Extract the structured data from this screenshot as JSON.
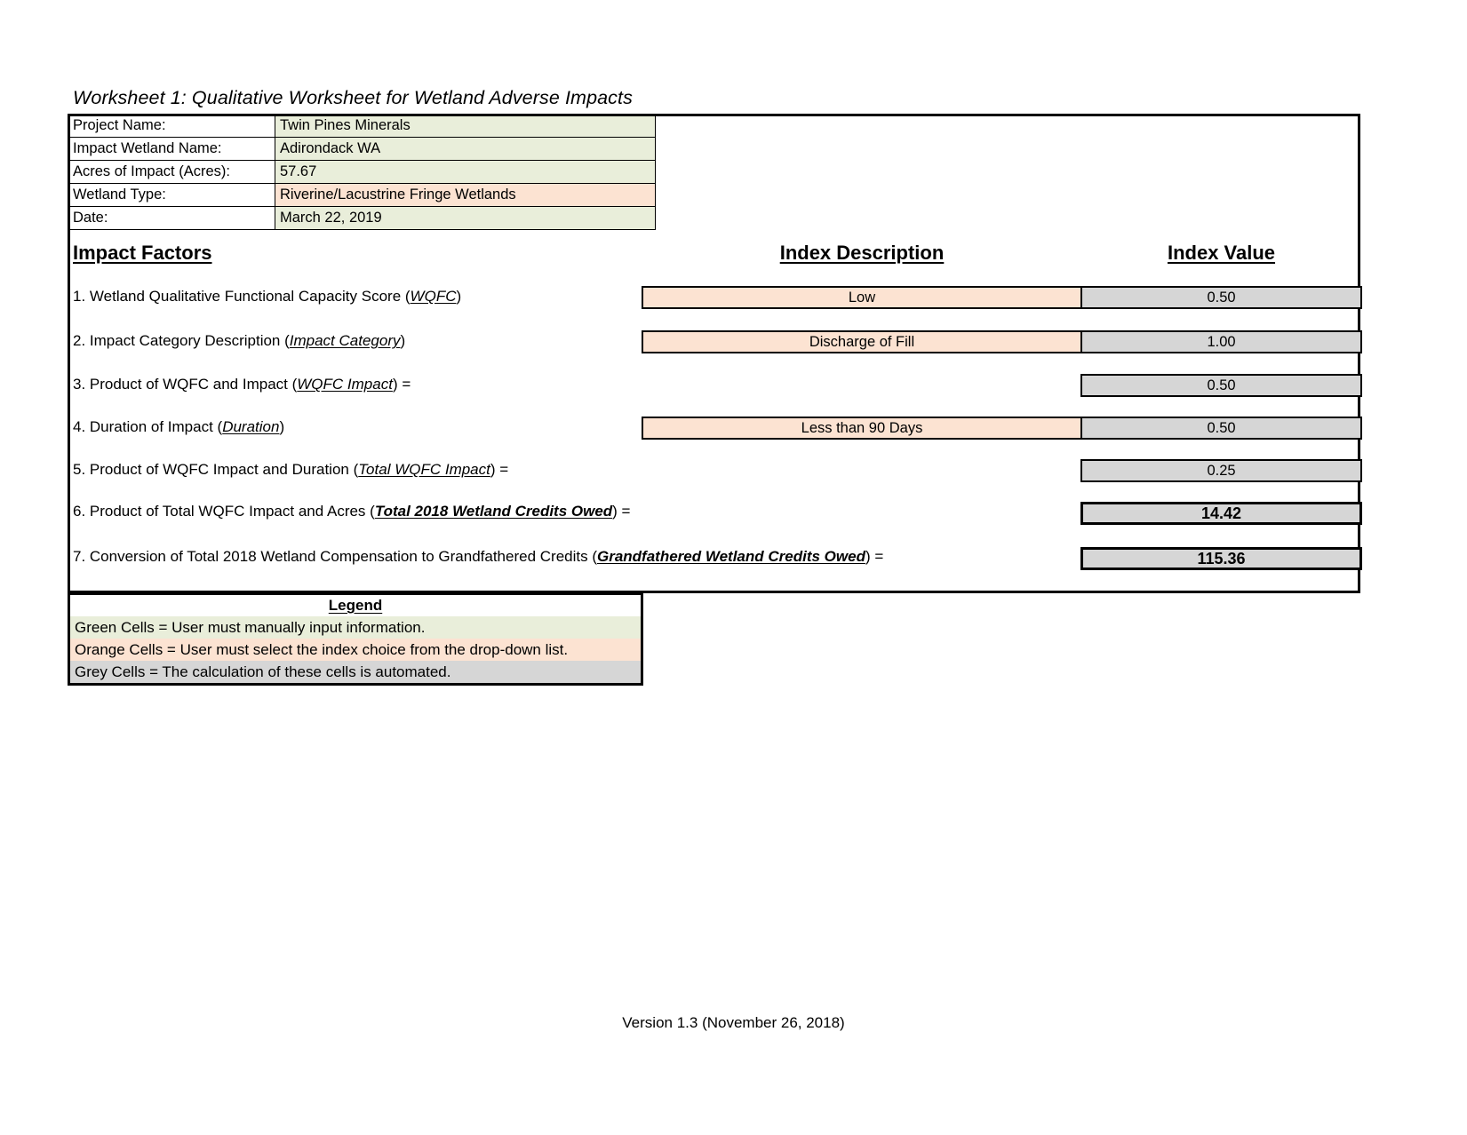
{
  "title": "Worksheet 1:  Qualitative Worksheet for Wetland Adverse Impacts",
  "info": {
    "rows": [
      {
        "label": "Project Name:",
        "value": "Twin Pines Minerals",
        "fill": "green"
      },
      {
        "label": "Impact Wetland Name:",
        "value": "Adirondack WA",
        "fill": "green"
      },
      {
        "label": "Acres of Impact (Acres):",
        "value": "57.67",
        "fill": "green"
      },
      {
        "label": "Wetland Type:",
        "value": "Riverine/Lacustrine Fringe Wetlands",
        "fill": "orange"
      },
      {
        "label": "Date:",
        "value": "March 22, 2019",
        "fill": "green"
      }
    ]
  },
  "columns": {
    "impact_factors": "Impact Factors",
    "index_description": "Index Description",
    "index_value": "Index Value"
  },
  "factors": [
    {
      "number": "1.",
      "text_before": "1. Wetland Qualitative Functional Capacity Score (",
      "term": "WQFC",
      "text_after": ")",
      "description": "Low",
      "value": "0.50"
    },
    {
      "number": "2.",
      "text_before": "2. Impact Category Description (",
      "term": "Impact Category",
      "text_after": ")",
      "description": "Discharge of Fill",
      "value": "1.00"
    },
    {
      "number": "3.",
      "text_before": "3. Product of WQFC and Impact (",
      "term": "WQFC Impact",
      "text_after": ") =",
      "description": "",
      "value": "0.50"
    },
    {
      "number": "4.",
      "text_before": "4. Duration of Impact (",
      "term": "Duration",
      "text_after": ")",
      "description": "Less than 90 Days",
      "value": "0.50"
    },
    {
      "number": "5.",
      "text_before": "5. Product of WQFC Impact and Duration (",
      "term": "Total WQFC Impact",
      "text_after": ") =",
      "description": "",
      "value": "0.25"
    },
    {
      "number": "6.",
      "text_before": "6. Product of Total WQFC Impact and Acres (",
      "term": "Total 2018 Wetland Credits Owed",
      "text_after": ") =",
      "description": "",
      "value": "14.42"
    },
    {
      "number": "7.",
      "text_before": "7. Conversion of Total 2018 Wetland Compensation to Grandfathered Credits (",
      "term": "Grandfathered Wetland Credits Owed",
      "text_after": ") =",
      "description": "",
      "value": "115.36"
    }
  ],
  "legend": {
    "title": "Legend",
    "rows": [
      {
        "text": "Green Cells = User must manually input information.",
        "fill": "green"
      },
      {
        "text": "Orange Cells = User must select the index choice from the drop-down list.",
        "fill": "orange"
      },
      {
        "text": "Grey Cells = The calculation of these cells is automated.",
        "fill": "grey"
      }
    ]
  },
  "footer": "Version 1.3 (November 26, 2018)",
  "colors": {
    "green": "#e9eeda",
    "orange": "#fce3d2",
    "grey": "#d6d6d6",
    "border": "#000000"
  }
}
